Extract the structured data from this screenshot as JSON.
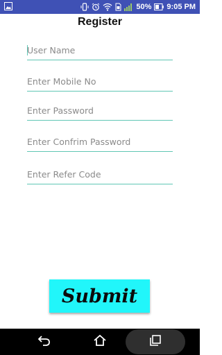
{
  "status_bar": {
    "battery": "50%",
    "time": "9:05 PM"
  },
  "page": {
    "title": "Register"
  },
  "form": {
    "fields": [
      {
        "placeholder": "User Name",
        "value": ""
      },
      {
        "placeholder": "Enter Mobile No",
        "value": ""
      },
      {
        "placeholder": "Enter Password",
        "value": ""
      },
      {
        "placeholder": "Enter Confrim Password",
        "value": ""
      },
      {
        "placeholder": "Enter Refer Code",
        "value": ""
      }
    ],
    "submit_label": "Submit"
  },
  "colors": {
    "status_bar": "#3f51b5",
    "underline": "#5fc6b4",
    "submit": "#21f6fa"
  }
}
